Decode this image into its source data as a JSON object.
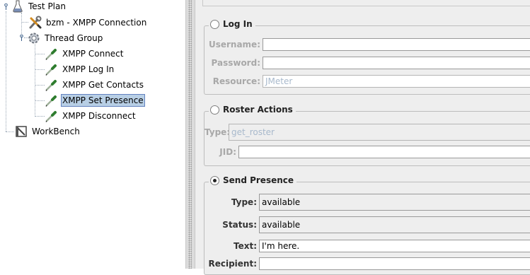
{
  "tree": {
    "test_plan": "Test Plan",
    "connection": "bzm - XMPP Connection",
    "thread_group": "Thread Group",
    "samplers": [
      "XMPP Connect",
      "XMPP Log In",
      "XMPP Get Contacts",
      "XMPP Set Presence",
      "XMPP Disconnect"
    ],
    "workbench": "WorkBench",
    "selected": "XMPP Set Presence"
  },
  "login": {
    "title": "Log In",
    "username_label": "Username:",
    "username_value": "",
    "password_label": "Password:",
    "password_value": "",
    "resource_label": "Resource:",
    "resource_value": "JMeter"
  },
  "roster": {
    "title": "Roster Actions",
    "type_label": "Type:",
    "type_value": "get_roster",
    "jid_label": "JID:",
    "jid_value": ""
  },
  "presence": {
    "title": "Send Presence",
    "type_label": "Type:",
    "type_value": "available",
    "status_label": "Status:",
    "status_value": "available",
    "text_label": "Text:",
    "text_value": "I'm here.",
    "recipient_label": "Recipient:",
    "recipient_value": ""
  },
  "colors": {
    "selection": "#b8cfe5",
    "panel_bg": "#eeeeee",
    "disabled_text": "#a8b9cc"
  }
}
